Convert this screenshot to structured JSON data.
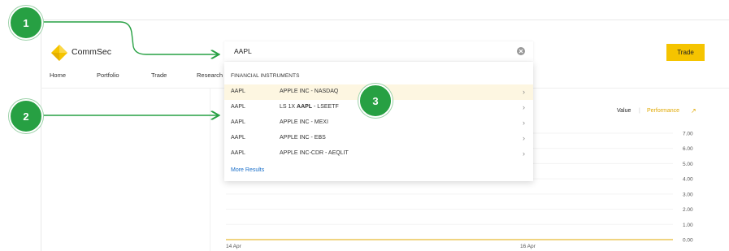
{
  "brand": {
    "name": "CommSec"
  },
  "search": {
    "value": "AAPL",
    "placeholder": ""
  },
  "trade_button": {
    "label": "Trade"
  },
  "nav": {
    "items": [
      "Home",
      "Portfolio",
      "Trade",
      "Research"
    ]
  },
  "dropdown": {
    "header": "FINANCIAL INSTRUMENTS",
    "results": [
      {
        "code": "AAPL",
        "name": "APPLE INC - NASDAQ",
        "highlighted": true
      },
      {
        "code": "AAPL",
        "name_prefix": "LS 1X ",
        "name_bold": "AAPL",
        "name_suffix": " - LSEETF"
      },
      {
        "code": "AAPL",
        "name": "APPLE INC - MEXI"
      },
      {
        "code": "AAPL",
        "name": "APPLE INC - EBS"
      },
      {
        "code": "AAPL",
        "name": "APPLE INC-CDR - AEQLIT"
      }
    ],
    "more_link": "More Results"
  },
  "chart_toggle": {
    "value_label": "Value",
    "separator": "|",
    "performance_label": "Performance",
    "expand_icon": "↗"
  },
  "chart_data": {
    "type": "line",
    "title": "",
    "xlabel": "",
    "ylabel": "",
    "x_ticks": [
      "14 Apr",
      "16 Apr"
    ],
    "y_ticks": [
      "7.00",
      "6.00",
      "5.00",
      "4.00",
      "3.00",
      "2.00",
      "1.00",
      "0.00"
    ],
    "ylim": [
      0,
      7
    ],
    "series": [
      {
        "values": [
          0,
          0
        ]
      }
    ],
    "grid": true
  },
  "annotations": {
    "callouts": [
      "1",
      "2",
      "3"
    ]
  },
  "colors": {
    "brand_yellow": "#f5c400",
    "link_blue": "#1a6fc9",
    "callout_green": "#27a043",
    "perf_orange": "#e0a800",
    "highlight_row": "#fdf6e1"
  },
  "icons": {
    "logo": "commsec-diamond-logo",
    "clear": "clear-circle-icon",
    "chevron": "chevron-right-icon"
  }
}
